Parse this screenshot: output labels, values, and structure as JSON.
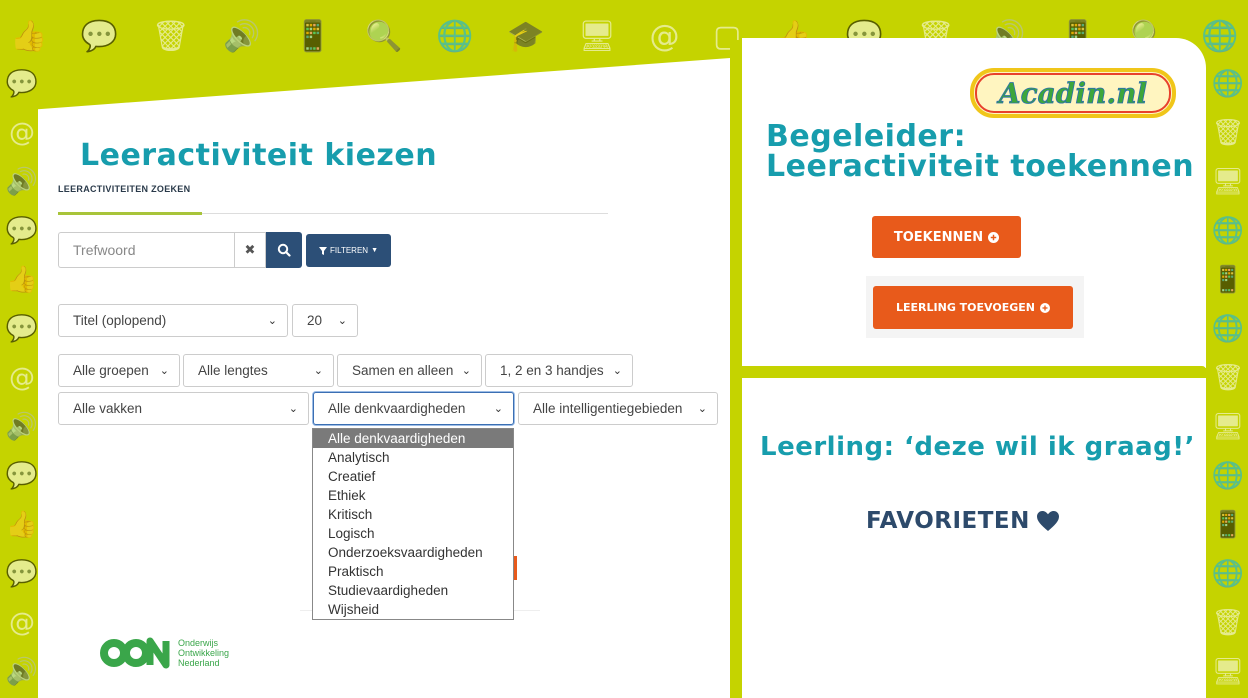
{
  "left": {
    "title": "Leeractiviteit kiezen",
    "tab_label": "LEERACTIVITEITEN ZOEKEN",
    "search_placeholder": "Trefwoord",
    "clear_symbol": "✖",
    "filter_label": "FILTEREN",
    "sort_select": "Titel (oplopend)",
    "count_select": "20",
    "filters_row1": [
      "Alle groepen",
      "Alle lengtes",
      "Samen en alleen",
      "1, 2 en 3 handjes"
    ],
    "filters_row2": [
      "Alle vakken",
      "Alle denkvaardigheden",
      "Alle intelligentiegebieden"
    ],
    "dropdown_options": [
      "Alle denkvaardigheden",
      "Analytisch",
      "Creatief",
      "Ethiek",
      "Kritisch",
      "Logisch",
      "Onderzoeksvaardigheden",
      "Praktisch",
      "Studievaardigheden",
      "Wijsheid"
    ],
    "dropdown_selected_index": 0,
    "oon_logo": {
      "mark": "OON",
      "lines": [
        "Onderwijs",
        "Ontwikkeling",
        "Nederland"
      ]
    }
  },
  "right_top": {
    "logo_text": "Acadin.nl",
    "title_line1": "Begeleider:",
    "title_line2": "Leeractiviteit toekennen",
    "toekennen_label": "TOEKENNEN",
    "leerling_label": "LEERLING TOEVOEGEN"
  },
  "right_bottom": {
    "title": "Leerling: ‘deze wil ik graag!’",
    "favorieten_label": "FAVORIETEN"
  },
  "colors": {
    "background": "#c5d300",
    "heading": "#179dad",
    "navy": "#2c4f77",
    "orange": "#e85a1b",
    "dark_text": "#2d4a6b"
  },
  "icons": {
    "search": "search-icon",
    "filter": "filter-icon",
    "chevron": "chevron-down-icon",
    "plus_circle": "plus-circle-icon",
    "heart": "heart-icon"
  }
}
